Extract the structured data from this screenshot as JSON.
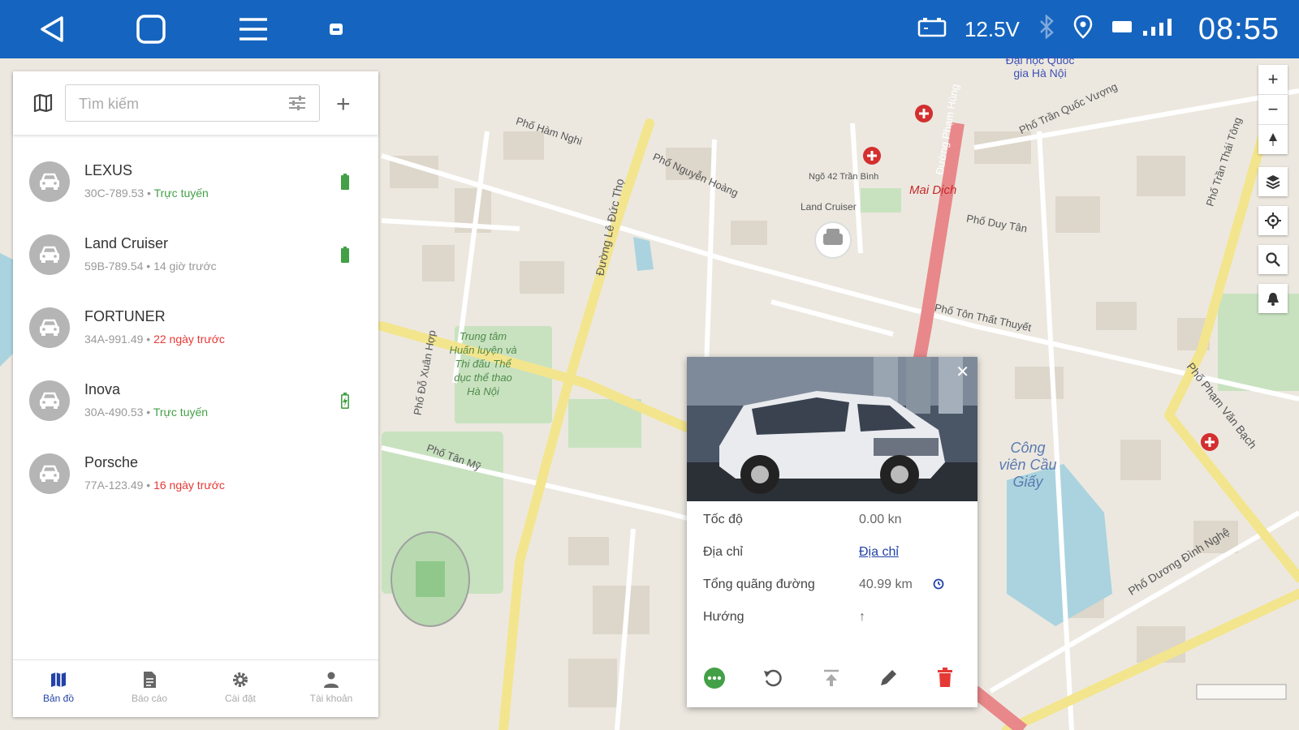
{
  "statusbar": {
    "voltage": "12.5V",
    "clock": "08:55",
    "icons": [
      "back-icon",
      "home-icon",
      "menu-icon",
      "app-icon",
      "battery-voltage-icon",
      "bluetooth-icon",
      "location-icon",
      "signal-icon"
    ]
  },
  "search": {
    "placeholder": "Tìm kiếm"
  },
  "vehicles": [
    {
      "name": "LEXUS",
      "plate": "30C-789.53",
      "status": "Trực tuyến",
      "status_color": "#43a047",
      "battery": "full"
    },
    {
      "name": "Land Cruiser",
      "plate": "59B-789.54",
      "status": "14 giờ trước",
      "status_color": "#999999",
      "battery": "full"
    },
    {
      "name": "FORTUNER",
      "plate": "34A-991.49",
      "status": "22 ngày trước",
      "status_color": "#e53935",
      "battery": "none"
    },
    {
      "name": "Inova",
      "plate": "30A-490.53",
      "status": "Trực tuyến",
      "status_color": "#43a047",
      "battery": "charging"
    },
    {
      "name": "Porsche",
      "plate": "77A-123.49",
      "status": "16 ngày trước",
      "status_color": "#e53935",
      "battery": "none"
    }
  ],
  "nav": {
    "items": [
      {
        "label": "Bản đồ",
        "icon": "map-icon",
        "active": true
      },
      {
        "label": "Báo cáo",
        "icon": "report-icon",
        "active": false
      },
      {
        "label": "Cài đặt",
        "icon": "settings-icon",
        "active": false
      },
      {
        "label": "Tài khoản",
        "icon": "account-icon",
        "active": false
      }
    ]
  },
  "popup": {
    "rows": [
      {
        "label": "Tốc độ",
        "value": "0.00 kn"
      },
      {
        "label": "Địa chỉ",
        "value": "Địa chỉ"
      },
      {
        "label": "Tổng quãng đường",
        "value": "40.99 km"
      },
      {
        "label": "Hướng",
        "value": "↑"
      }
    ],
    "address_link_color": "#2343a8"
  },
  "map_labels": {
    "l1": "Đại học Quốc gia Hà Nội",
    "l2": "Phố Trần Quốc Vượng",
    "l3": "Phố Hàm Nghi",
    "l4": "Phố Nguyễn Hoàng",
    "l5": "Ngõ 42 Trần Bình",
    "l6": "Land Cruiser",
    "l7": "Mai Dịch",
    "l8": "Phố Duy Tân",
    "l9": "Đường Lê Đức Thọ",
    "l10": "Phố Tôn Thất Thuyết",
    "l11": "Công viên Cầu Giấy",
    "l12": "Phố Dương Đình Nghệ",
    "l13": "Phố Phạm Văn Bạch",
    "l14": "Trung tâm Huấn luyện và Thi đấu Thể dục thể thao Hà Nội",
    "l15": "Phố Trần Thái Tông",
    "l16": "Đường Phạm Hùng",
    "l17": "Phố Tân Mỹ",
    "l18": "Phố Đỗ Xuân Hợp"
  },
  "colors": {
    "primary": "#1565c0",
    "accent": "#2343a8",
    "online": "#43a047",
    "offline_old": "#e53935",
    "delete": "#e53935",
    "ellipsis_button": "#43a047"
  }
}
